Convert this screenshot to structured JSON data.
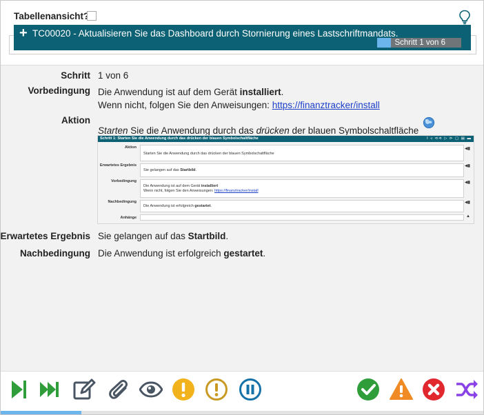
{
  "header": {
    "table_view_label": "Tabellenansicht?",
    "table_view_checked": false,
    "test_case_title": "TC00020 - Aktualisieren Sie das Dashboard durch Stornierung eines Lastschriftmandats.",
    "progress_label": "Schritt 1 von 6",
    "progress_fraction": 0.167
  },
  "details": {
    "step_label": "Schritt",
    "step_value": "1 von 6",
    "precondition_label": "Vorbedingung",
    "precondition_line1_a": "Die Anwendung ist auf dem Gerät ",
    "precondition_line1_b": "installiert",
    "precondition_line1_c": ".",
    "precondition_line2_a": "Wenn nicht, folgen Sie den Anweisungen: ",
    "precondition_link": "https://finanztracker/install",
    "action_label": "Aktion",
    "action_a": "Starten",
    "action_b": " Sie die Anwendung durch das ",
    "action_c": "drücken",
    "action_d": " der blauen Symbolschaltfläche",
    "expected_label": "Erwartetes Ergebnis",
    "expected_a": "Sie gelangen auf das ",
    "expected_b": "Startbild",
    "expected_c": ".",
    "postcondition_label": "Nachbedingung",
    "postcondition_a": "Die Anwendung ist erfolgreich ",
    "postcondition_b": "gestartet",
    "postcondition_c": "."
  },
  "preview": {
    "title": "Schritt 1: Starten Sie die Anwendung durch das drücken der blauen Symbolschaltfläche",
    "action_label": "Aktion",
    "action_text": "Starten Sie die Anwendung durch das drücken der blauen Symbolschaltfläche",
    "expected_label": "Erwartetes Ergebnis",
    "expected_a": "Sie gelangen auf das ",
    "expected_b": "Startbild",
    "expected_c": ".",
    "precondition_label": "Vorbedingung",
    "precondition_line1_a": "Die Anwendung ist auf dem Gerät ",
    "precondition_line1_b": "installiert",
    "precondition_line2_a": "Wenn nicht, folgen Sie den Anweisungen: ",
    "precondition_link": "https://finanztracker/install",
    "postcondition_label": "Nachbedingung",
    "postcondition_a": "Die Anwendung ist erfolgreich ",
    "postcondition_b": "gestartet",
    "postcondition_c": ".",
    "attachments_label": "Anhänge"
  },
  "toolbar": {
    "icons": [
      "play-step-icon",
      "fast-forward-icon",
      "edit-icon",
      "attachment-icon",
      "view-icon",
      "warning-yellow-icon",
      "warning-gold-icon",
      "pause-icon",
      "pass-icon",
      "blocked-icon",
      "fail-icon",
      "shuffle-icon"
    ],
    "progress_fraction": 0.167
  },
  "colors": {
    "header_bg": "#0c6174",
    "progress_fill": "#6cb4ec",
    "green": "#2f9e3a",
    "yellow": "#f2b21b",
    "gold": "#c99a23",
    "blue": "#1572a8",
    "orange": "#f08a24",
    "red": "#e0282e",
    "purple": "#8a42e6"
  }
}
